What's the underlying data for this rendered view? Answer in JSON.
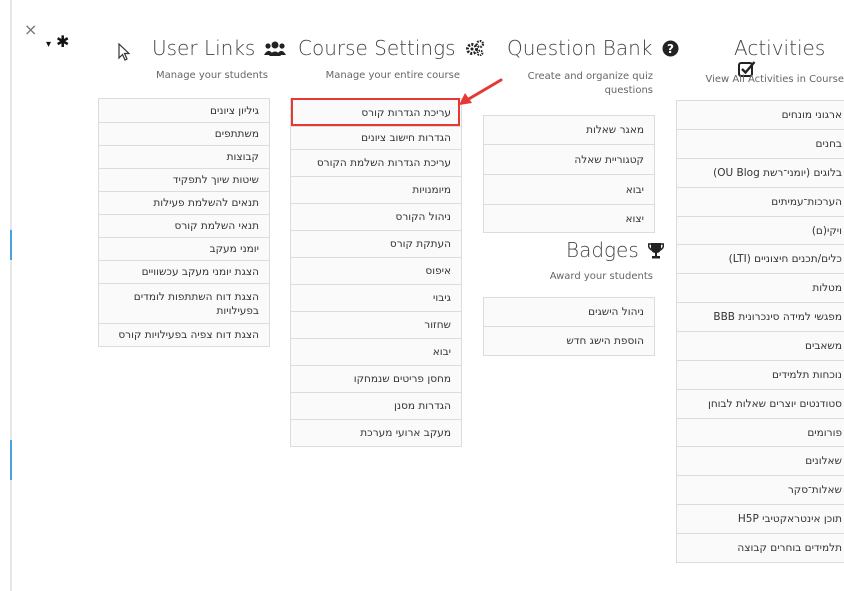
{
  "controls": {
    "close": "×"
  },
  "user_links": {
    "title": "User Links",
    "icon": "users-icon",
    "subtitle": "Manage your students",
    "items": [
      "גיליון ציונים",
      "משתתפים",
      "קבוצות",
      "שיטות שיוך לתפקיד",
      "תנאים להשלמת פעילות",
      "תנאי השלמת קורס",
      "יומני מעקב",
      "הצגת יומני מעקב עכשוויים",
      "הצגת דוח השתתפות לומדים בפעילויות",
      "הצגת דוח צפיה בפעילויות קורס"
    ]
  },
  "course_settings": {
    "title": "Course Settings",
    "icon": "cogs-icon",
    "subtitle": "Manage your entire course",
    "items": [
      "עריכת הגדרות קורס",
      "הגדרות חישוב ציונים",
      "עריכת הגדרות השלמת הקורס",
      "מיומנויות",
      "ניהול הקורס",
      "העתקת קורס",
      "איפוס",
      "גיבוי",
      "שחזור",
      "יבוא",
      "מחסן פריטים שנמחקו",
      "הגדרות מסנן",
      "מעקב ארועי מערכת"
    ]
  },
  "question_bank": {
    "title": "Question Bank",
    "icon": "question-circle-icon",
    "subtitle": "Create and organize quiz questions",
    "items": [
      "מאגר שאלות",
      "קטגוריית שאלה",
      "יבוא",
      "יצוא"
    ]
  },
  "badges": {
    "title": "Badges",
    "icon": "trophy-icon",
    "subtitle": "Award your students",
    "items": [
      "ניהול הישגים",
      "הוספת הישג חדש"
    ]
  },
  "activities": {
    "title": "Activities",
    "icon": "check-square-icon",
    "subtitle": "View All Activities in Course",
    "items": [
      "ארגוני מונחים",
      "בחנים",
      "בלוגים (יומני־רשת OU Blog)",
      "הערכות־עמיתים",
      "ויקי(ם)",
      "כלים/תכנים חיצוניים (LTI)",
      "מטלות",
      "מפגשי למידה סינכרונית BBB",
      "משאבים",
      "נוכחות תלמידים",
      "סטודנטים יוצרים שאלות לבוחן",
      "פורומים",
      "שאלונים",
      "שאלות־סקר",
      "תוכן אינטראקטיבי H5P",
      "תלמידים בוחרים קבוצה"
    ]
  },
  "colors": {
    "highlight": "#e53935",
    "border": "#dcdcdc",
    "row_bg": "#fafafa"
  }
}
